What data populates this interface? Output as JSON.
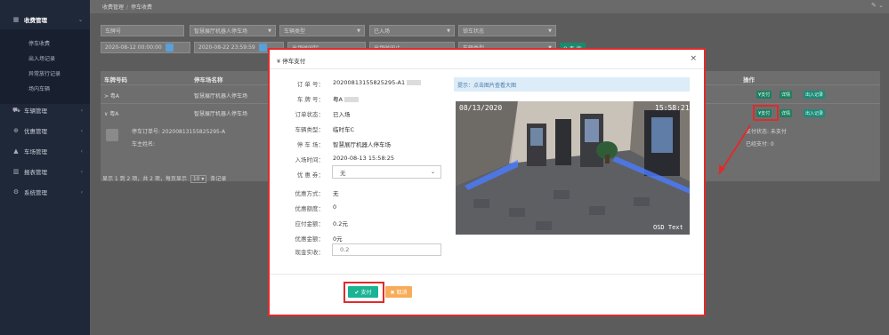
{
  "sidebar": {
    "groups": [
      {
        "label": "收费管理",
        "icon": "grid-icon",
        "active": true,
        "children": [
          "停车收费",
          "出入场记录",
          "异常放行记录",
          "场内车辆"
        ]
      },
      {
        "label": "车辆管理",
        "icon": "car-icon"
      },
      {
        "label": "优惠管理",
        "icon": "discount-icon"
      },
      {
        "label": "车场管理",
        "icon": "parking-icon"
      },
      {
        "label": "报表管理",
        "icon": "chart-icon"
      },
      {
        "label": "系统管理",
        "icon": "gear-icon"
      }
    ]
  },
  "breadcrumb": {
    "root": "收费管理",
    "sep": "/",
    "current": "停车收费"
  },
  "filters": {
    "plate_placeholder": "车牌号",
    "lot_value": "智慧展厅机器人停车场",
    "vehicle_type": "车辆类型",
    "entry_status": "已入场",
    "lock_status": "锁车状态",
    "start_time": "2020-08-12 00:00:00",
    "end_time": "2020-08-22 23:59:59",
    "exit_from": "出场时间起",
    "exit_to": "出场时间止",
    "car_type": "车辆类型",
    "search": "Q 查 询"
  },
  "table": {
    "headers": [
      "车牌号码",
      "停车场名称",
      "操作"
    ],
    "rows": [
      {
        "plate": "> 粤A",
        "lot": "智慧展厅机器人停车场"
      },
      {
        "plate": "∨ 粤A",
        "lot": "智慧展厅机器人停车场"
      }
    ],
    "actions": {
      "pay": "¥支付",
      "detail": "详情",
      "records": "出入记录"
    },
    "detail": {
      "order_label": "停车订单号: 20200813155825295-A",
      "owner_label": "车主姓名:",
      "pay_status": "支付状态: 未支付",
      "paid": "已经支付: 0"
    },
    "pager": {
      "prefix": "显示 1 到 2 项，共 2 项，每页显示",
      "size": "10",
      "suffix": "条记录"
    }
  },
  "modal": {
    "title": "¥ 停车支付",
    "close": "×",
    "fields": [
      {
        "label": "订 单 号：",
        "value": "20200813155825295-A1"
      },
      {
        "label": "车 牌 号：",
        "value": "粤A"
      },
      {
        "label": "订单状态：",
        "value": "已入场"
      },
      {
        "label": "车辆类型：",
        "value": "临时车C"
      },
      {
        "label": "停 车 场：",
        "value": "智慧展厅机器人停车场"
      },
      {
        "label": "入场时间：",
        "value": "2020-08-13 15:58:25"
      }
    ],
    "coupon_label": "优 惠 券：",
    "coupon_value": "无",
    "fields2": [
      {
        "label": "优惠方式：",
        "value": "无"
      },
      {
        "label": "优惠额度：",
        "value": "0"
      },
      {
        "label": "应付金额：",
        "value": "0.2元"
      },
      {
        "label": "优惠金额：",
        "value": "0元"
      }
    ],
    "cash_label": "现金实收：",
    "cash_value": "0.2",
    "hint": "提示：点击图片查看大图",
    "photo": {
      "date": "08/13/2020",
      "time": "15:58:21",
      "osd": "OSD Text"
    },
    "pay_button": "✔ 支付",
    "cancel_button": "✖ 取消"
  },
  "colors": {
    "accent": "#1ab394",
    "warning": "#f8ac59",
    "highlight": "#e02b2b",
    "sidebar": "#1f2838"
  }
}
